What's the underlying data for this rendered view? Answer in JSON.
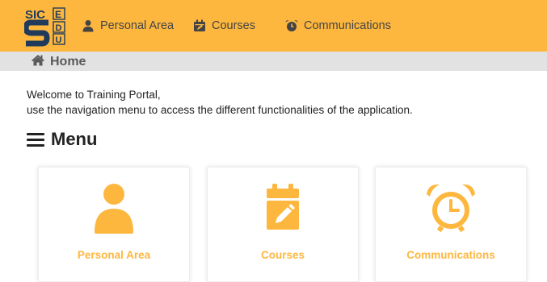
{
  "colors": {
    "accent": "#fdb73f",
    "breadcrumb_bg": "#e2e2e2",
    "nav_text": "#444444"
  },
  "logo": {
    "line1": "SICE",
    "line2": "SDU"
  },
  "nav": {
    "items": [
      {
        "label": "Personal Area",
        "icon": "user-icon"
      },
      {
        "label": "Courses",
        "icon": "calendar-icon"
      },
      {
        "label": "Communications",
        "icon": "alarm-clock-icon"
      }
    ]
  },
  "breadcrumb": {
    "home_label": "Home",
    "icon": "home-icon"
  },
  "welcome": {
    "line1": "Welcome to Training Portal,",
    "line2": "use the navigation menu to access the different functionalities of the application."
  },
  "menu": {
    "title": "Menu",
    "icon": "hamburger-icon",
    "cards": [
      {
        "label": "Personal Area",
        "icon": "user-icon"
      },
      {
        "label": "Courses",
        "icon": "calendar-edit-icon"
      },
      {
        "label": "Communications",
        "icon": "alarm-clock-icon"
      }
    ]
  }
}
